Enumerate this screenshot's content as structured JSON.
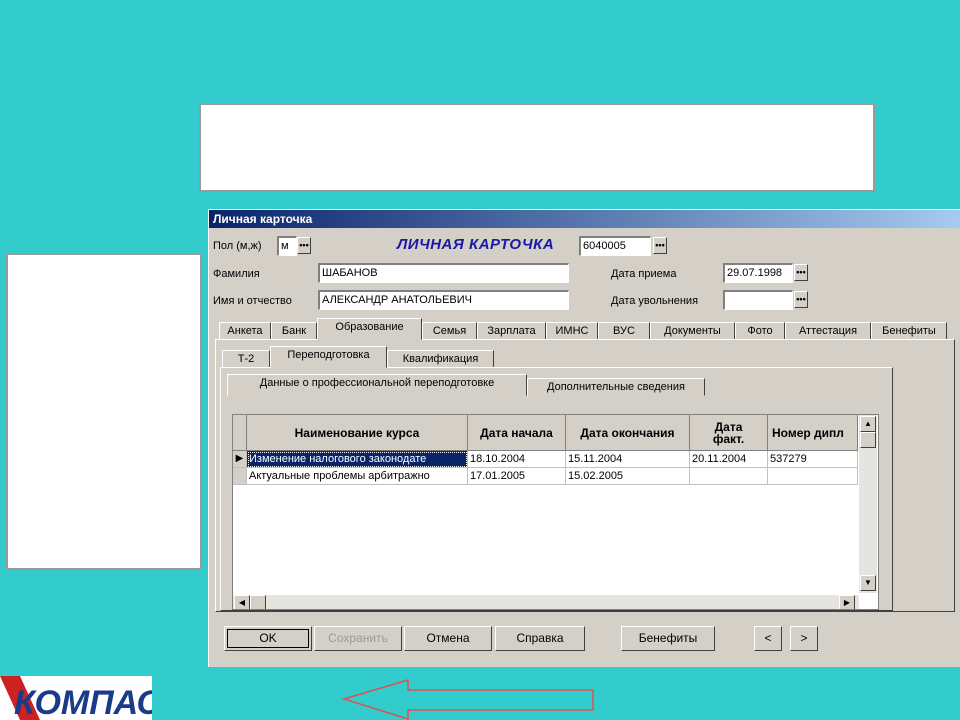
{
  "window": {
    "title": "Личная карточка"
  },
  "header": {
    "gender_label": "Пол (м,ж)",
    "gender_value": "м",
    "card_title": "ЛИЧНАЯ КАРТОЧКА",
    "card_number": "6040005",
    "surname_label": "Фамилия",
    "surname_value": "ШАБАНОВ",
    "name_label": "Имя и отчество",
    "name_value": "АЛЕКСАНДР АНАТОЛЬЕВИЧ",
    "hire_date_label": "Дата приема",
    "hire_date_value": "29.07.1998",
    "dismissal_date_label": "Дата увольнения",
    "dismissal_date_value": ""
  },
  "main_tabs": [
    "Анкета",
    "Банк",
    "Образование",
    "Семья",
    "Зарплата",
    "ИМНС",
    "ВУС",
    "Документы",
    "Фото",
    "Аттестация",
    "Бенефиты"
  ],
  "sub_tabs": [
    "Т-2",
    "Переподготовка",
    "Квалификация"
  ],
  "inner_tabs": [
    "Данные о профессиональной переподготовке",
    "Дополнительные сведения"
  ],
  "grid": {
    "columns": [
      "Наименование курса",
      "Дата начала",
      "Дата окончания",
      "Дата факт.",
      "Номер дипл"
    ],
    "rows": [
      [
        "Изменение налогового законодате",
        "18.10.2004",
        "15.11.2004",
        "20.11.2004",
        "537279"
      ],
      [
        "Актуальные проблемы арбитражно",
        "17.01.2005",
        "15.02.2005",
        "",
        ""
      ]
    ]
  },
  "buttons": {
    "ok": "OK",
    "save": "Сохранить",
    "cancel": "Отмена",
    "help": "Справка",
    "benefits": "Бенефиты",
    "prev": "<",
    "next": ">"
  },
  "icons": {
    "ellipsis": "•••",
    "row_pointer": "▶",
    "arrow_up": "▲",
    "arrow_down": "▼",
    "arrow_left": "◀",
    "arrow_right": "▶"
  },
  "logo": {
    "text": "КОМПАС"
  },
  "colors": {
    "background": "#33CCCC",
    "window": "#D4D0C8",
    "title_blue": "#0A246A",
    "selection": "#0A246A",
    "arrow": "#E05050"
  }
}
